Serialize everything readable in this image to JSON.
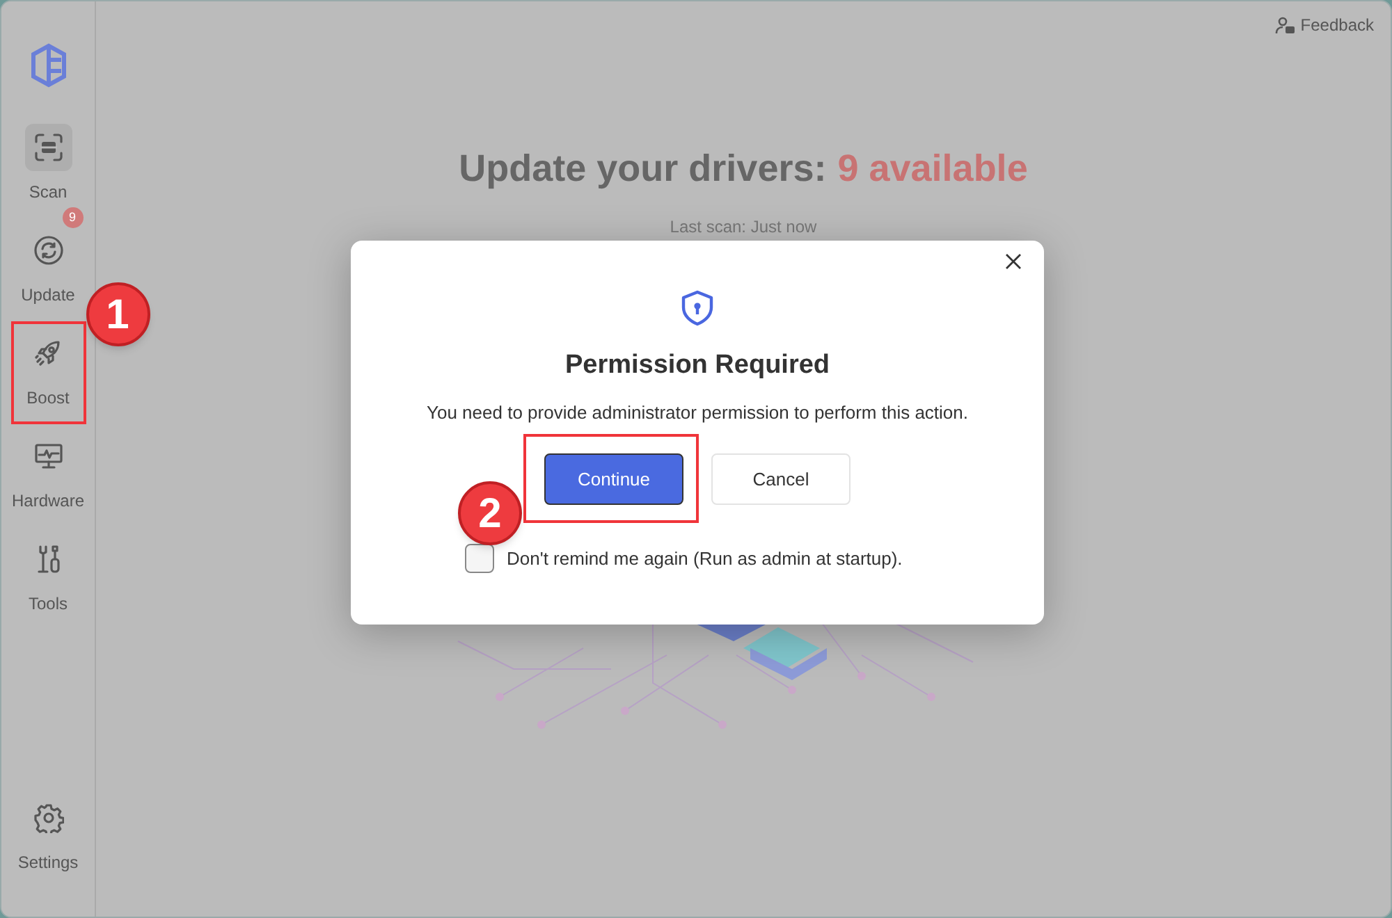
{
  "header": {
    "feedback": "Feedback"
  },
  "sidebar": {
    "items": [
      {
        "label": "Scan",
        "selected": true
      },
      {
        "label": "Update",
        "selected": false,
        "badge": "9"
      },
      {
        "label": "Boost",
        "selected": false,
        "callout": "1"
      },
      {
        "label": "Hardware",
        "selected": false
      },
      {
        "label": "Tools",
        "selected": false
      }
    ],
    "footer": {
      "label": "Settings",
      "selected": false
    }
  },
  "main": {
    "title": "Update your drivers:",
    "title_count": "9 available",
    "subtitle": "Last scan: Just now"
  },
  "dialog": {
    "title": "Permission Required",
    "message": "You need to provide administrator permission to perform this action.",
    "buttons": [
      {
        "label": "Continue",
        "kind": "primary",
        "callout": "2"
      },
      {
        "label": "Cancel",
        "kind": "secondary"
      }
    ],
    "checkbox": {
      "label": "Don't remind me again (Run as admin at startup).",
      "checked": false
    }
  }
}
